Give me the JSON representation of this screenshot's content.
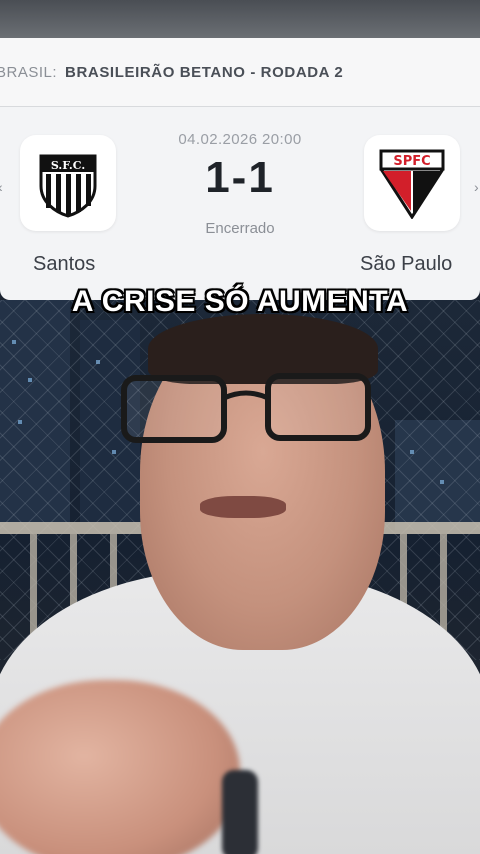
{
  "league": {
    "country": "BRASIL:",
    "name": "BRASILEIRÃO BETANO - RODADA 2"
  },
  "match": {
    "datetime": "04.02.2026 20:00",
    "score": "1-1",
    "status": "Encerrado",
    "home": {
      "name": "Santos",
      "crest_icon": "santos-crest-icon",
      "crest_text": "S.F.C."
    },
    "away": {
      "name": "São Paulo",
      "crest_icon": "spfc-crest-icon",
      "crest_text": "SPFC"
    }
  },
  "caption": "A CRISE SÓ AUMENTA",
  "colors": {
    "card_bg": "#f3f4f6",
    "score": "#1f2329",
    "spfc_red": "#d21f2a",
    "caption_fill": "#ffffff",
    "caption_stroke": "#000000"
  }
}
